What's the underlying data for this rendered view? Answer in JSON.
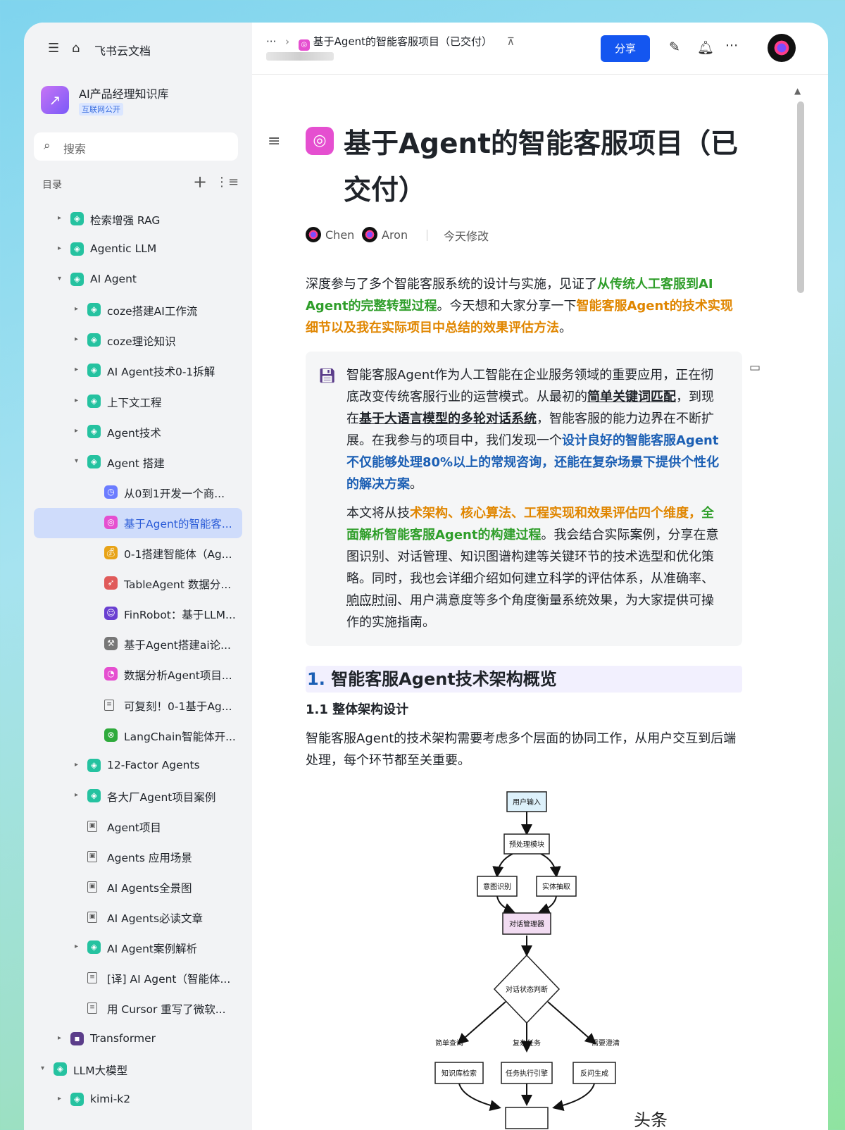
{
  "app": {
    "name": "飞书云文档"
  },
  "knowledge_base": {
    "title": "AI产品经理知识库",
    "badge": "互联网公开"
  },
  "search": {
    "placeholder": "搜索"
  },
  "toc": {
    "label": "目录"
  },
  "tree": [
    {
      "label": "检索增强 RAG",
      "level": 1,
      "arrow": "▸",
      "icon": "tag-icon"
    },
    {
      "label": "Agentic LLM",
      "level": 1,
      "arrow": "▸",
      "icon": "tag-icon"
    },
    {
      "label": "AI Agent",
      "level": 1,
      "arrow": "▾",
      "icon": "tag-icon"
    },
    {
      "label": "coze搭建AI工作流",
      "level": 2,
      "arrow": "▸",
      "icon": "tag-icon"
    },
    {
      "label": "coze理论知识",
      "level": 2,
      "arrow": "▸",
      "icon": "tag-icon"
    },
    {
      "label": "AI Agent技术0-1拆解",
      "level": 2,
      "arrow": "▸",
      "icon": "tag-icon"
    },
    {
      "label": "上下文工程",
      "level": 2,
      "arrow": "▸",
      "icon": "tag-icon"
    },
    {
      "label": "Agent技术",
      "level": 2,
      "arrow": "▸",
      "icon": "tag-icon"
    },
    {
      "label": "Agent 搭建",
      "level": 2,
      "arrow": "▾",
      "icon": "tag-icon"
    },
    {
      "label": "从0到1开发一个商...",
      "level": 3,
      "arrow": "",
      "icon": "clock-icon"
    },
    {
      "label": "基于Agent的智能客...",
      "level": 3,
      "arrow": "",
      "icon": "gamepad-icon",
      "selected": true
    },
    {
      "label": "0-1搭建智能体（Ag...",
      "level": 3,
      "arrow": "",
      "icon": "money-bag-icon"
    },
    {
      "label": "TableAgent 数据分...",
      "level": 3,
      "arrow": "",
      "icon": "rocket-icon"
    },
    {
      "label": "FinRobot：基于LLM...",
      "level": 3,
      "arrow": "",
      "icon": "robot-icon"
    },
    {
      "label": "基于Agent搭建ai论...",
      "level": 3,
      "arrow": "",
      "icon": "tools-icon"
    },
    {
      "label": "数据分析Agent项目...",
      "level": 3,
      "arrow": "",
      "icon": "chart-icon"
    },
    {
      "label": "可复刻！0-1基于Ag...",
      "level": 3,
      "arrow": "",
      "icon": "doc-icon"
    },
    {
      "label": "LangChain智能体开...",
      "level": 3,
      "arrow": "",
      "icon": "chain-icon"
    },
    {
      "label": "12-Factor Agents",
      "level": 2,
      "arrow": "▸",
      "icon": "tag-icon"
    },
    {
      "label": "各大厂Agent项目案例",
      "level": 2,
      "arrow": "▸",
      "icon": "tag-icon"
    },
    {
      "label": "Agent项目",
      "level": 2,
      "arrow": "",
      "icon": "board-icon"
    },
    {
      "label": "Agents 应用场景",
      "level": 2,
      "arrow": "",
      "icon": "board-icon"
    },
    {
      "label": "AI Agents全景图",
      "level": 2,
      "arrow": "",
      "icon": "board-icon"
    },
    {
      "label": "AI Agents必读文章",
      "level": 2,
      "arrow": "",
      "icon": "board-icon"
    },
    {
      "label": "AI Agent案例解析",
      "level": 2,
      "arrow": "▸",
      "icon": "tag-icon"
    },
    {
      "label": "[译] AI Agent（智能体...",
      "level": 2,
      "arrow": "",
      "icon": "doc-icon"
    },
    {
      "label": "用 Cursor 重写了微软...",
      "level": 2,
      "arrow": "",
      "icon": "doc-icon"
    },
    {
      "label": "Transformer",
      "level": 1,
      "arrow": "▸",
      "icon": "floppy-icon"
    },
    {
      "label": "LLM大模型",
      "level": 0,
      "arrow": "▾",
      "icon": "tag-icon"
    },
    {
      "label": "kimi-k2",
      "level": 1,
      "arrow": "▸",
      "icon": "tag-icon"
    }
  ],
  "header": {
    "breadcrumb_more": "···",
    "breadcrumb_title": "基于Agent的智能客服项目（已交付）",
    "share_label": "分享"
  },
  "doc": {
    "title": "基于Agent的智能客服项目（已交付）",
    "authors": [
      "Chen",
      "Aron"
    ],
    "modified": "今天修改",
    "intro": {
      "p1": "深度参与了多个智能客服系统的设计与实施，见证了",
      "hl1": "从传统人工客服到AI Agent的完整转型过程",
      "p2": "。今天想和大家分享一下",
      "hl2": "智能客服Agent的技术实现细节以及我在实际项目中总结的效果评估方法",
      "p3": "。"
    },
    "callout": {
      "a1": "智能客服Agent作为人工智能在企业服务领域的重要应用，正在彻底改变传统客服行业的运营模式。从最初的",
      "u1": "简单关键词匹配",
      "a2": "，到现在",
      "u2": "基于大语言模型的多轮对话系统",
      "a3": "，智能客服的能力边界在不断扩展。在我参与的项目中，我们发现一个",
      "b1": "设计良好的智能客服Agent不仅能够处理80%以上的常规咨询，还能在复杂场景下提供个性化的解决方案",
      "a4": "。",
      "c1": "本文将从技",
      "o1": "术架构、核心算法、工程实现和效果评估四个维度，",
      "g1": "全面解析智能客服Agent的构建过程",
      "c2": "。我会结合实际案例，分享在意图识别、对话管理、知识图谱构建等关键环节的技术选型和优化策略。同时，我也会详细介绍如何建立科学的评估体系，从准确率、",
      "d1": "响应时间",
      "c3": "、用户满意度等多个角度衡量系统效果，为大家提供可操作的实施指南。"
    },
    "h1_num": "1.",
    "h1_text": "智能客服Agent技术架构概览",
    "h2": "1.1 整体架构设计",
    "para": "智能客服Agent的技术架构需要考虑多个层面的协同工作，从用户交互到后端处理，每个环节都至关重要。"
  },
  "diagram": {
    "nodes": {
      "input": "用户输入",
      "preprocess": "预处理模块",
      "intent": "意图识别",
      "entity": "实体抽取",
      "dialog": "对话管理器",
      "state": "对话状态判断",
      "kb": "知识库检索",
      "task": "任务执行引擎",
      "reply": "反问生成"
    },
    "edges": {
      "simple": "简单查询",
      "complex": "复杂任务",
      "clarify": "需要澄清"
    }
  },
  "watermark": "头条"
}
